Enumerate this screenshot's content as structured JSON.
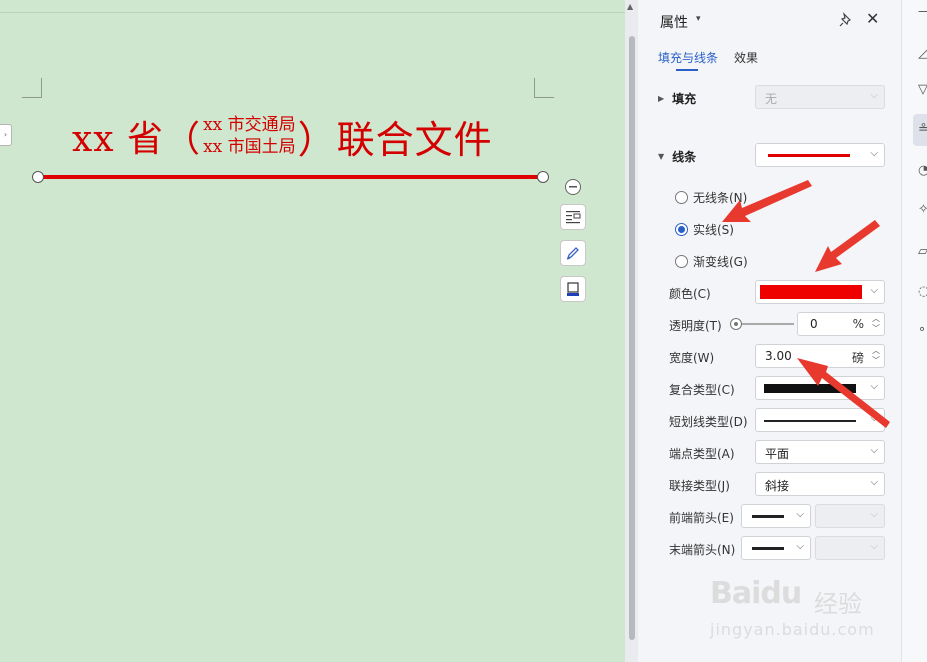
{
  "document": {
    "title_prefix": "xx 省（",
    "title_line1": "xx 市交通局",
    "title_line2": "xx 市国土局",
    "title_suffix": "）联合文件",
    "title_color": "#d40000",
    "rule_color": "#e00000"
  },
  "panel": {
    "title": "属性",
    "tabs": [
      "填充与线条",
      "效果"
    ],
    "active_tab": "填充与线条",
    "fill": {
      "label": "填充",
      "value": "无"
    },
    "line": {
      "label": "线条",
      "options": {
        "none": "无线条(N)",
        "solid": "实线(S)",
        "gradient": "渐变线(G)"
      },
      "selected": "实线(S)",
      "color_label": "颜色(C)",
      "color_value": "#ee0000",
      "transparency_label": "透明度(T)",
      "transparency_value": "0",
      "transparency_unit": "%",
      "width_label": "宽度(W)",
      "width_value": "3.00",
      "width_unit": "磅",
      "compound_label": "复合类型(C)",
      "dash_label": "短划线类型(D)",
      "cap_label": "端点类型(A)",
      "cap_value": "平面",
      "join_label": "联接类型(J)",
      "join_value": "斜接",
      "begin_arrow_label": "前端箭头(E)",
      "end_arrow_label": "末端箭头(N)"
    }
  },
  "watermark": {
    "brand": "Baidu",
    "brand_cn": "经验",
    "url": "jingyan.baidu.com"
  },
  "icons": {
    "pin": "pin-icon",
    "close": "close-icon",
    "collapse": "minus-circle-icon",
    "layout": "layout-options-icon",
    "pen": "pen-icon",
    "fill": "fill-color-icon"
  },
  "colors": {
    "accent": "#2a5fc8",
    "arrow": "#e8392f",
    "canvas": "#cfe6cf"
  }
}
